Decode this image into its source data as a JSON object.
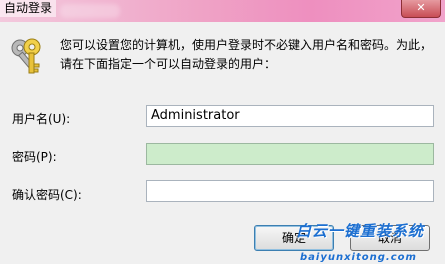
{
  "window": {
    "title": "自动登录",
    "close_glyph": "✕"
  },
  "description": "您可以设置您的计算机，使用户登录时不必键入用户名和密码。为此，请在下面指定一个可以自动登录的用户：",
  "fields": {
    "username": {
      "label": "用户名(U):",
      "value": "Administrator"
    },
    "password": {
      "label": "密码(P):",
      "value": ""
    },
    "confirm": {
      "label": "确认密码(C):",
      "value": ""
    }
  },
  "buttons": {
    "ok": "确定",
    "cancel": "取消"
  },
  "watermark": {
    "text": "白云一键重装系统",
    "url": "baiyunxitong.com"
  },
  "colors": {
    "titlebar": "#ee8fbf",
    "password_field": "#cdeccb",
    "watermark": "#1c6fd1"
  },
  "icons": {
    "dialog": "key-icon"
  }
}
